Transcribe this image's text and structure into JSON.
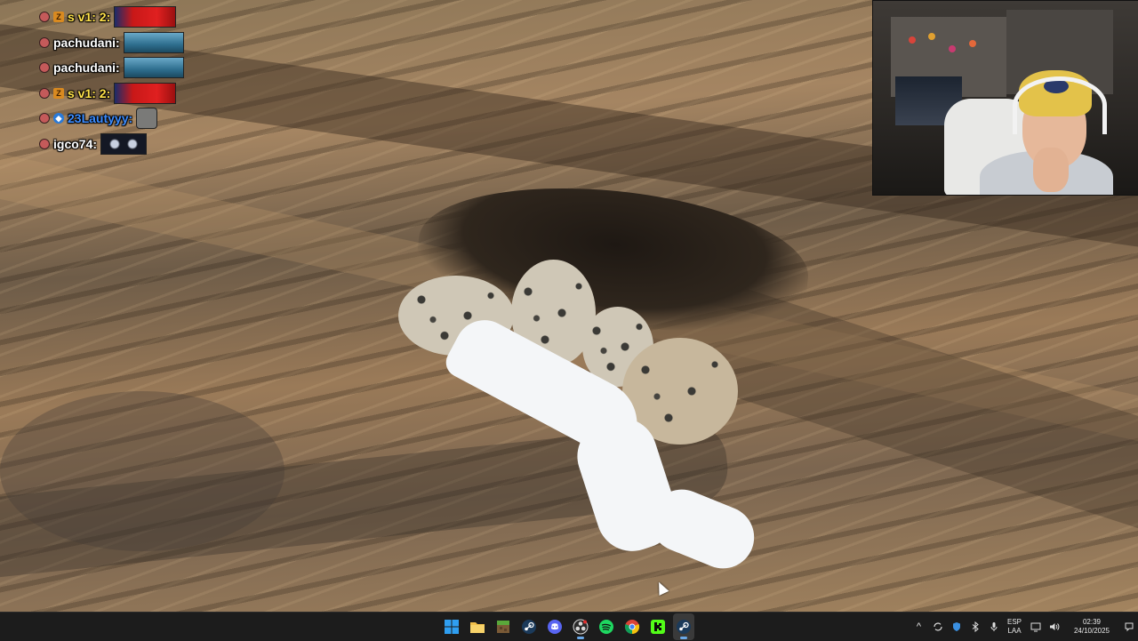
{
  "chat": {
    "messages": [
      {
        "user": "s v1: 2:",
        "badge": "Z",
        "emote": "red-blue-emote",
        "color": "#ffe24a"
      },
      {
        "user": "pachudani:",
        "badge": "",
        "emote": "teal-wave-emote",
        "color": "#ffffff"
      },
      {
        "user": "pachudani:",
        "badge": "",
        "emote": "teal-wave-emote",
        "color": "#ffffff"
      },
      {
        "user": "s v1: 2:",
        "badge": "Z",
        "emote": "red-blue-emote",
        "color": "#ffe24a"
      },
      {
        "user": "23Lautyyy:",
        "badge": "◆",
        "emote": "mask-emote",
        "color": "#3b8cff"
      },
      {
        "user": "igco74:",
        "badge": "",
        "emote": "dark-faces-emote",
        "color": "#ffffff"
      }
    ]
  },
  "taskbar": {
    "apps": [
      {
        "name": "Start",
        "icon": "windows-icon"
      },
      {
        "name": "File Explorer",
        "icon": "folder-icon"
      },
      {
        "name": "Minecraft",
        "icon": "grass-block-icon"
      },
      {
        "name": "Steam",
        "icon": "steam-icon"
      },
      {
        "name": "Discord",
        "icon": "discord-icon"
      },
      {
        "name": "OBS",
        "icon": "obs-icon"
      },
      {
        "name": "Spotify",
        "icon": "spotify-icon"
      },
      {
        "name": "Chrome",
        "icon": "chrome-icon"
      },
      {
        "name": "Kick",
        "icon": "kick-icon"
      },
      {
        "name": "Steam",
        "icon": "steam-icon"
      }
    ],
    "tray": {
      "language_top": "ESP",
      "language_bottom": "LAA",
      "time": "02:39",
      "date": "24/10/2025"
    },
    "accent": "#6aa8e8"
  }
}
